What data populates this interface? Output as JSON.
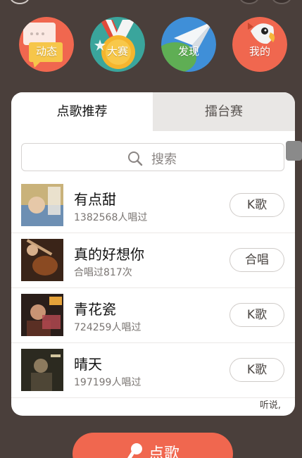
{
  "nav": {
    "items": [
      {
        "label": "动态",
        "icon": "chat-bubble-icon",
        "color": "#f0674f"
      },
      {
        "label": "大赛",
        "icon": "medal-icon",
        "color": "#f0674f"
      },
      {
        "label": "发现",
        "icon": "paper-plane-icon",
        "color": "#3f8fd8"
      },
      {
        "label": "我的",
        "icon": "parrot-icon",
        "color": "#f0674f"
      }
    ]
  },
  "tabs": [
    {
      "label": "点歌推荐",
      "active": true
    },
    {
      "label": "擂台赛",
      "active": false
    }
  ],
  "search": {
    "placeholder": "搜索"
  },
  "songs": [
    {
      "title": "有点甜",
      "subtitle": "1382568人唱过",
      "action": "K歌"
    },
    {
      "title": "真的好想你",
      "subtitle": "合唱过817次",
      "action": "合唱"
    },
    {
      "title": "青花瓷",
      "subtitle": "724259人唱过",
      "action": "K歌"
    },
    {
      "title": "晴天",
      "subtitle": "197199人唱过",
      "action": "K歌"
    }
  ],
  "footer_note": "听说,",
  "sing_button": {
    "label": "点歌"
  },
  "colors": {
    "accent": "#f0674f",
    "background": "#4a3f3b",
    "tab_inactive": "#e9e7e5"
  }
}
